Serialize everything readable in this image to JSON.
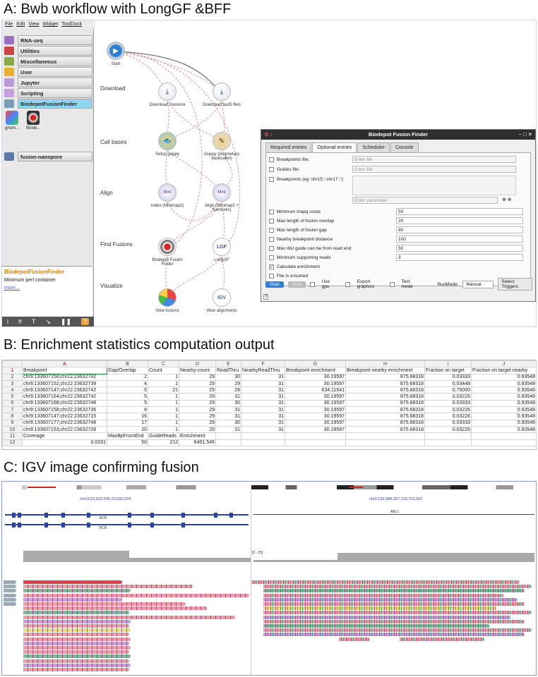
{
  "sectionA": {
    "title": "A: Bwb workflow with LongGF &BFF",
    "menu": [
      "File",
      "Edit",
      "View",
      "Widget",
      "ToolDock"
    ],
    "toolbox": [
      "RNA-seq",
      "Utilities",
      "Miscellaneous",
      "User",
      "Jupyter",
      "Scripting",
      "BiodepotFusionFinder",
      "fusion-nanopore"
    ],
    "tool_icons": [
      "gnum...",
      "Biode..."
    ],
    "desc": {
      "title": "BiodepotFusionFinder",
      "text": "Minimum perl container",
      "more": "more..."
    },
    "stages": [
      "Download",
      "Call bases",
      "Align",
      "Find Fusions",
      "Visualize"
    ],
    "nodes": {
      "start": "Start",
      "dl_genome": "Download Genome",
      "dl_fast5": "Download fast5 files",
      "setup_guppy": "Setup guppy",
      "guppy": "Guppy (proprietary basecaller)",
      "index": "Index (Minimap2)",
      "align": "Align (Minimap2 + Samtools)",
      "bff": "Biodepot Fusion Finder",
      "longgf": "LongGF",
      "view_fusions": "View fusions",
      "view_alignments": "View alignments"
    },
    "dialog": {
      "title": "Biodepot Fusion Finder",
      "tabs": [
        "Required entries",
        "Optional entries",
        "Scheduler",
        "Console"
      ],
      "breakpoints_file": "Breakpoints file:",
      "guides_file": "Guides file:",
      "breakpoints_eg": "Breakpoints (eg 'chr15:::chr17::'):",
      "enter_file": "Enter file",
      "enter_param": "Enter parameter",
      "params": [
        {
          "label": "Minimum mapq score",
          "value": "50"
        },
        {
          "label": "Max length of fusion overlap",
          "value": "20"
        },
        {
          "label": "Max length of fusion gap",
          "value": "80"
        },
        {
          "label": "Nearby breakpoint distance",
          "value": "100"
        },
        {
          "label": "Max dist guide can be from read end",
          "value": "50"
        },
        {
          "label": "Minimum supporting reads",
          "value": "3"
        }
      ],
      "calc_enrichment": "Calculate enrichment",
      "file_unsorted": "File is unsorted",
      "start": "Start",
      "stop": "Stop",
      "use_gpu": "Use gpu",
      "export_graphics": "Export graphics",
      "test_mode": "Test mode",
      "runmode_label": "RunMode:",
      "runmode": "Manual",
      "select_triggers": "Select Triggers"
    }
  },
  "sectionB": {
    "title": "B: Enrichment statistics computation output",
    "cols": [
      "",
      "A",
      "B",
      "C",
      "D",
      "E",
      "F",
      "G",
      "H",
      "I",
      "J"
    ],
    "rows": [
      [
        "1",
        "Breakpoint",
        "Gap/Overlap",
        "Count",
        "Nearby-count",
        "ReadThru",
        "NearbyReadThru",
        "Breakpoint enrichment",
        "Breakpoint nearby enrichment",
        "Fraction on target",
        "Fraction on target nearby"
      ],
      [
        "2",
        "chr9:133607156;chr22:23632742",
        "2",
        "1",
        "29",
        "30",
        "31",
        "30.19597",
        "875.68318",
        "0.03333",
        "0.93548"
      ],
      [
        "3",
        "chr9:133607152;chr22:23632739",
        "4",
        "1",
        "29",
        "29",
        "31",
        "30.19597",
        "875.68318",
        "0.03448",
        "0.93548"
      ],
      [
        "4",
        "chr9:133607147;chr22:23632742",
        "5",
        "21",
        "29",
        "28",
        "31",
        "634.11541",
        "875.68318",
        "0.75000",
        "0.93548"
      ],
      [
        "5",
        "chr9:133607164;chr22:23632742",
        "5",
        "1",
        "29",
        "31",
        "31",
        "30.19597",
        "875.68318",
        "0.03226",
        "0.93548"
      ],
      [
        "6",
        "chr9:133607168;chr22:23632748",
        "5",
        "1",
        "29",
        "30",
        "31",
        "30.19597",
        "875.68318",
        "0.03333",
        "0.93548"
      ],
      [
        "7",
        "chr9:133607158;chr22:23632736",
        "8",
        "1",
        "29",
        "31",
        "31",
        "30.19597",
        "875.68318",
        "0.03226",
        "0.93548"
      ],
      [
        "8",
        "chr9:133607147;chr22:23632715",
        "16",
        "1",
        "29",
        "31",
        "31",
        "30.19597",
        "875.68318",
        "0.03226",
        "0.93548"
      ],
      [
        "9",
        "chr9:133607177;chr22:23632748",
        "17",
        "1",
        "29",
        "30",
        "31",
        "30.19597",
        "875.68318",
        "0.03333",
        "0.93548"
      ],
      [
        "10",
        "chr9:133607153;chr22:23632728",
        "20",
        "1",
        "29",
        "31",
        "31",
        "30.19597",
        "875.68318",
        "0.03226",
        "0.93548"
      ],
      [
        "11",
        "Coverage",
        "MaxBpFromEnd",
        "GuideReads",
        "Enrichment",
        "",
        "",
        "",
        "",
        "",
        ""
      ],
      [
        "12",
        "0.0331",
        "50",
        "212",
        "6401.546",
        "",
        "",
        "",
        "",
        "",
        ""
      ]
    ]
  },
  "sectionC": {
    "title": "C: IGV image confirming fusion",
    "locus_left": "chr22:23,522,695-23,660,224",
    "locus_right": "chr9:133,589,267-133,763,062",
    "gene_bcr": "BCR",
    "gene_abl": "ABL1",
    "scale": "[0 - 25]",
    "colors": {
      "read_pink": "#e8a0a8",
      "read_green": "#7fb89a",
      "read_lavender": "#c8a0d8",
      "read_yellow": "#e6e080",
      "mismatch": "#b04080"
    }
  }
}
